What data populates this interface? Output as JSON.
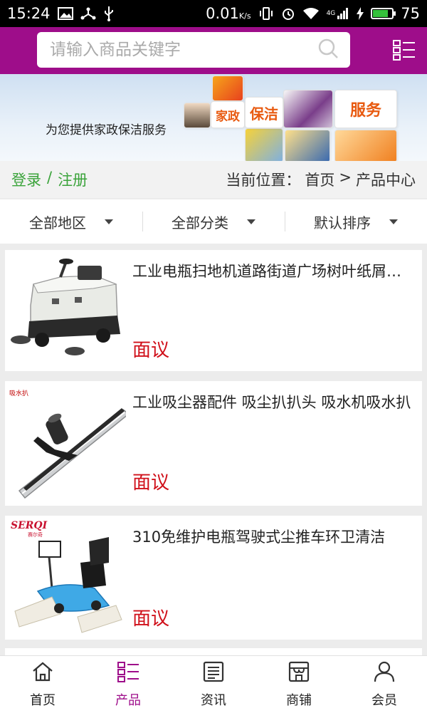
{
  "status_bar": {
    "time": "15:24",
    "speed": "0.01",
    "speed_unit": "K/s",
    "network": "4G",
    "battery": "75"
  },
  "header": {
    "search_placeholder": "请输入商品关键字",
    "brand_color": "#9e0d8a"
  },
  "banner": {
    "tagline": "为您提供家政保洁服务",
    "words": [
      "家政",
      "保洁",
      "服务"
    ]
  },
  "breadcrumb": {
    "login": "登录",
    "separator": "/",
    "register": "注册",
    "location_label": "当前位置：",
    "home": "首页",
    "arrow": ">",
    "current": "产品中心"
  },
  "filters": [
    {
      "label": "全部地区"
    },
    {
      "label": "全部分类"
    },
    {
      "label": "默认排序"
    }
  ],
  "products": [
    {
      "title": "工业电瓶扫地机道路街道广场树叶纸屑清扫车",
      "price": "面议"
    },
    {
      "title": "工业吸尘器配件 吸尘扒扒头 吸水机吸水扒",
      "price": "面议",
      "image_caption": "吸水扒"
    },
    {
      "title": "310免维护电瓶驾驶式尘推车环卫清洁",
      "price": "面议",
      "image_brand": "SERQI",
      "image_brand_sub": "赛尔奇"
    }
  ],
  "bottom_nav": [
    {
      "label": "首页",
      "icon": "home-icon",
      "active": false
    },
    {
      "label": "产品",
      "icon": "list-icon",
      "active": true
    },
    {
      "label": "资讯",
      "icon": "news-icon",
      "active": false
    },
    {
      "label": "商铺",
      "icon": "shop-icon",
      "active": false
    },
    {
      "label": "会员",
      "icon": "user-icon",
      "active": false
    }
  ]
}
